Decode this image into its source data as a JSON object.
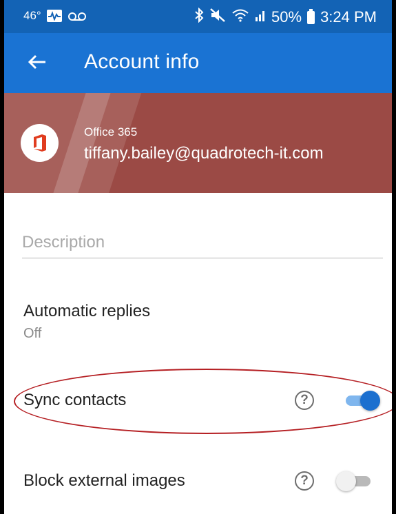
{
  "status_bar": {
    "temperature": "46°",
    "battery_percent": "50%",
    "time": "3:24 PM"
  },
  "app_bar": {
    "title": "Account info"
  },
  "account": {
    "type": "Office 365",
    "email": "tiffany.bailey@quadrotech-it.com"
  },
  "description": {
    "placeholder": "Description",
    "value": ""
  },
  "automatic_replies": {
    "label": "Automatic replies",
    "status": "Off"
  },
  "sync_contacts": {
    "label": "Sync contacts",
    "enabled": true
  },
  "block_external_images": {
    "label": "Block external images",
    "enabled": false
  },
  "colors": {
    "status_bar": "#1363b5",
    "app_bar": "#1a73d3",
    "header": "#9b4a45",
    "office_red": "#e03c1f",
    "toggle_on": "#1b6fcf",
    "highlight": "#b51f23"
  },
  "icons": {
    "back": "arrow-left-icon",
    "help": "question-mark-icon",
    "office": "office-logo-icon"
  }
}
